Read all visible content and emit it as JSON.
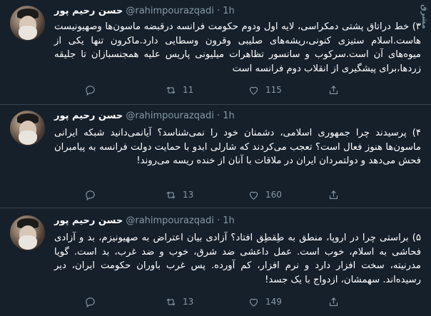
{
  "watermark": "مشرق",
  "tweets": [
    {
      "name": "حسن رحیم پور",
      "handle": "@rahimpourazqadi",
      "time": "1h",
      "text": "۳) خط دراتاق پشتی دمکراسی، لایه اول ودوم حکومت فرانسه درقبضه ماسون‌ها وصهیونیست هاست.اسلام ستیزی کنونی،ریشه‌های صلیبی وقرون وسطایی دارد.ماکرون تنها یکی از میوه‌های آن است.سرکوب و سانسور  تظاهرات میلیونی پاریس علیه همجنسبازان تا جلیقه زردها،برای پیشگیری از انقلاب دوم فرانسه است",
      "replies": "",
      "retweets": "11",
      "likes": "115"
    },
    {
      "name": "حسن رحیم پور",
      "handle": "@rahimpourazqadi",
      "time": "1h",
      "text": "۴) پرسیدند چرا جمهوری اسلامی، دشمنان خود را نمی‌شناسد؟ آیانمی‌دانید شبکه ایرانی ماسون‌ها هنوز فعال است؟ تعجب می‌کردند که شارلی ابدو با حمایت دولت فرانسه به پیامبران فحش می‌دهد و دولتمردان ایران در ملاقات با آنان از خنده ریسه می‌روند!",
      "replies": "",
      "retweets": "13",
      "likes": "160"
    },
    {
      "name": "حسن رحیم پور",
      "handle": "@rahimpourazqadi",
      "time": "1h",
      "text": "۵) براستی چرا در اروپا، منطق به طِقطِق افتاد؟ آزادی بیان اعتراض به صهیونیزم، بد و آزادی فحاشی به اسلام، خوب است. عمل داعشی ضد شرق، خوب و ضد غرب، بد است. گویا مدرنیته، سخت افزار دارد و نرم افزار، کم آورده. پس غرب باوران حکومت ایران، دیر رسیده‌اند. سهمشان، ازدواج با یک جسد!",
      "replies": "",
      "retweets": "13",
      "likes": "149"
    }
  ]
}
